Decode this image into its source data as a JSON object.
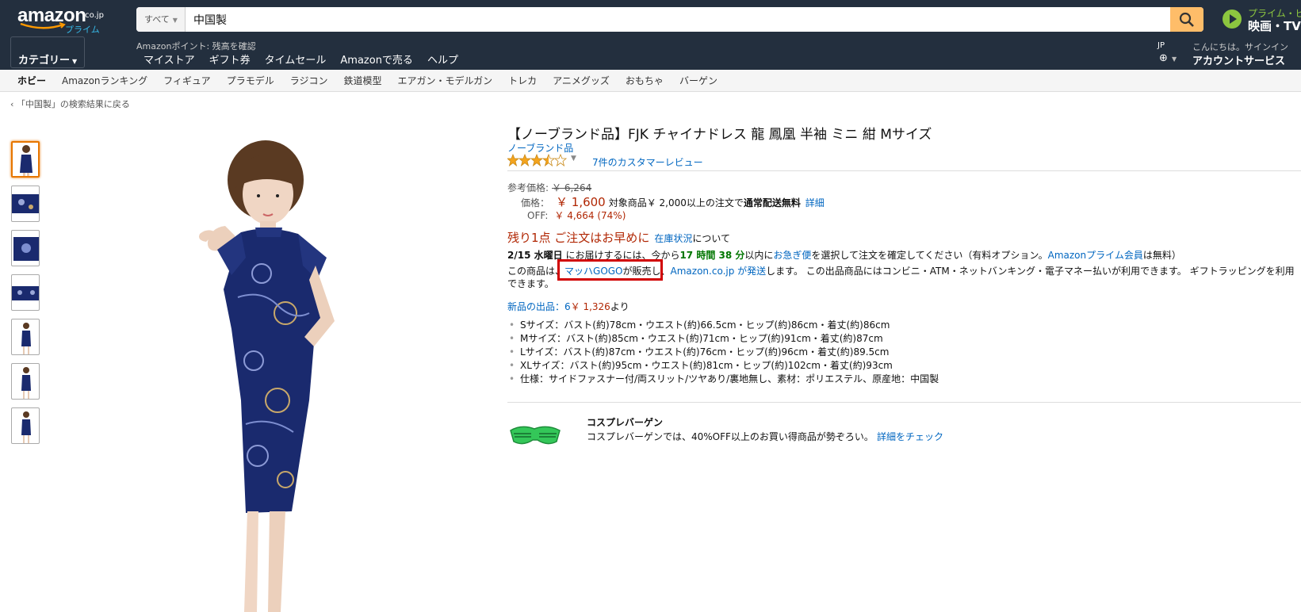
{
  "header": {
    "logo_text": "amazon",
    "logo_tld": ".co.jp",
    "logo_sub": "プライム",
    "search": {
      "department": "すべて",
      "query": "中国製"
    },
    "prime_video": {
      "line1": "プライム・ビ",
      "line2": "映画・TV番"
    },
    "category_label": "カテゴリー",
    "points_label": "Amazonポイント: 残高を確認",
    "nav_links": [
      "マイストア",
      "ギフト券",
      "タイムセール",
      "Amazonで売る",
      "ヘルプ"
    ],
    "lang": "JP",
    "account": {
      "greeting": "こんにちは。サインイン",
      "label": "アカウントサービス"
    }
  },
  "subnav": [
    "ホビー",
    "Amazonランキング",
    "フィギュア",
    "プラモデル",
    "ラジコン",
    "鉄道模型",
    "エアガン・モデルガン",
    "トレカ",
    "アニメグッズ",
    "おもちゃ",
    "バーゲン"
  ],
  "breadcrumb": "‹ 「中国製」の検索結果に戻る",
  "product": {
    "title": "【ノーブランド品】FJK チャイナドレス 龍 鳳凰 半袖 ミニ 紺 Mサイズ",
    "brand": "ノーブランド品",
    "rating": 3.5,
    "reviews": "7件のカスタマーレビュー",
    "list_price_label": "参考価格:",
    "list_price": "￥ 6,264",
    "price_label": "価格：",
    "price": "￥ 1,600",
    "shipping_prefix": "対象商品￥ 2,000以上の注文で",
    "shipping_bold": "通常配送無料",
    "shipping_detail": "詳細",
    "off_label": "OFF:",
    "off_value": "￥ 4,664 (74%)",
    "stock": "残り1点 ご注文はお早めに",
    "stock_link": "在庫状況",
    "stock_tail": "について",
    "delivery": {
      "date": "2/15 水曜日",
      "mid": " にお届けするには、今から",
      "countdown": "17 時間 38 分",
      "after": "以内に",
      "express": "お急ぎ便",
      "tail": "を選択して注文を確定してください（有料オプション。",
      "prime": "Amazonプライム会員",
      "end": "は無料）"
    },
    "seller": {
      "prefix": "この商品は、",
      "seller_name": "マッハGOGO",
      "sold": "が販売し、",
      "fulfilled": "Amazon.co.jp が発送",
      "tail": "します。 この出品商品にはコンビニ・ATM・ネットバンキング・電子マネー払いが利用できます。 ギフトラッピングを利用できます。"
    },
    "new_offers_link": "新品の出品：6",
    "new_offers_price": "￥ 1,326",
    "new_offers_tail": "より",
    "features": [
      "Sサイズ：バスト(約)78cm・ウエスト(約)66.5cm・ヒップ(約)86cm・着丈(約)86cm",
      "Mサイズ：バスト(約)85cm・ウエスト(約)71cm・ヒップ(約)91cm・着丈(約)87cm",
      "Lサイズ：バスト(約)87cm・ウエスト(約)76cm・ヒップ(約)96cm・着丈(約)89.5cm",
      "XLサイズ：バスト(約)95cm・ウエスト(約)81cm・ヒップ(約)102cm・着丈(約)93cm",
      "仕様：サイドファスナー付/両スリット/ツヤあり/裏地無し、素材：ポリエステル、原産地：中国製"
    ]
  },
  "promo": {
    "title": "コスプレバーゲン",
    "text": "コスプレバーゲンでは、40%OFF以上のお買い得商品が勢ぞろい。",
    "link": "詳細をチェック"
  },
  "colors": {
    "nav_bg": "#232f3e",
    "link": "#0066c0",
    "price": "#b12704",
    "highlight": "#d10000",
    "search_button": "#febd69",
    "dress": "#1a2a6e"
  },
  "icons": [
    "search-icon",
    "play-icon",
    "globe-icon",
    "star-icon",
    "sunglasses-icon"
  ]
}
